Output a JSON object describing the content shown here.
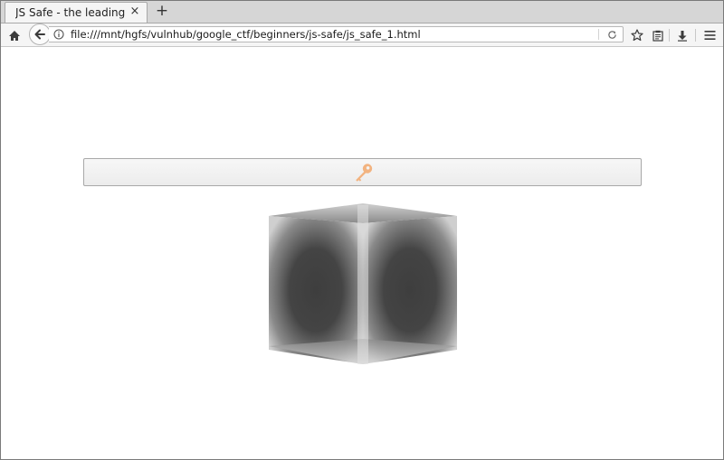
{
  "browser": {
    "tab_title": "JS Safe - the leading loca...",
    "tab_close_glyph": "×",
    "new_tab_glyph": "+",
    "url": "file:///mnt/hgfs/vulnhub/google_ctf/beginners/js-safe/js_safe_1.html"
  },
  "icons": {
    "home": "home-icon",
    "back": "back-arrow-icon",
    "info": "info-icon",
    "reload": "reload-icon",
    "bookmark": "star-icon",
    "reader": "reader-view-icon",
    "download": "download-icon",
    "menu": "hamburger-menu-icon",
    "key": "key-icon"
  },
  "colors": {
    "key_accent": "#f2b380",
    "cube_dark": "#3e3e3e"
  }
}
